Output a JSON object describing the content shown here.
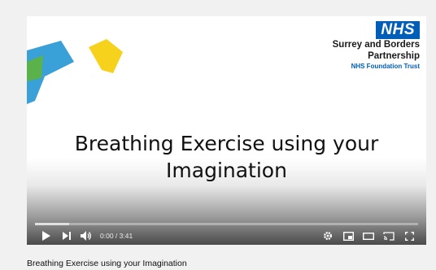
{
  "slide": {
    "org_badge": "NHS",
    "org_line1": "Surrey and Borders",
    "org_line2": "Partnership",
    "org_line3": "NHS Foundation Trust",
    "title_line1": "Breathing Exercise using your",
    "title_line2": "Imagination"
  },
  "player": {
    "time_current": "0:00",
    "time_total": "3:41",
    "played_fraction": 0
  },
  "video": {
    "title": "Breathing Exercise using your Imagination"
  },
  "colors": {
    "nhs_blue": "#005eb8",
    "shape_blue": "#3aa0d8",
    "shape_green": "#5bb14a",
    "shape_yellow": "#f7d21c"
  },
  "icons": {
    "play": "play-icon",
    "next": "next-icon",
    "volume": "volume-icon",
    "settings": "gear-icon",
    "miniplayer": "miniplayer-icon",
    "theater": "theater-icon",
    "cast": "cast-icon",
    "fullscreen": "fullscreen-icon"
  }
}
